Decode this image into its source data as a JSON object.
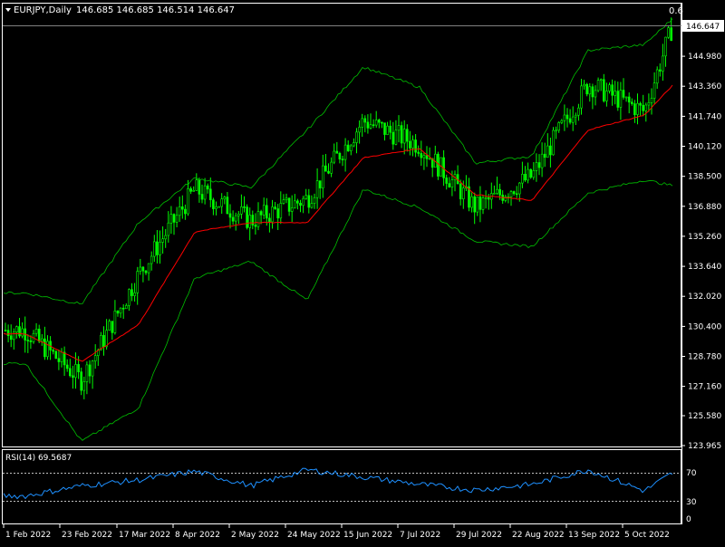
{
  "header": {
    "dropdown_icon": "triangle-down-icon",
    "symbol": "EURJPY,Daily",
    "ohlc": "146.685 146.685 146.514 146.647",
    "corner_value": "0.6"
  },
  "colors": {
    "background": "#000000",
    "candle": "#00ff00",
    "bands": "#00c000",
    "ma": "#ff0000",
    "rsi": "#1e90ff",
    "axis_text": "#ffffff",
    "current_price_bg": "#ffffff"
  },
  "price_axis": {
    "current_price": "146.647",
    "labels": [
      "144.980",
      "143.360",
      "141.740",
      "140.120",
      "138.500",
      "136.880",
      "135.260",
      "133.640",
      "132.020",
      "130.400",
      "128.780",
      "127.160",
      "125.580",
      "123.965"
    ]
  },
  "rsi_panel": {
    "label": "RSI(14) 69.5687",
    "levels": [
      "70",
      "30"
    ],
    "axis_labels": [
      "70",
      "30",
      "0"
    ]
  },
  "time_axis": {
    "labels": [
      "1 Feb 2022",
      "23 Feb 2022",
      "17 Mar 2022",
      "8 Apr 2022",
      "2 May 2022",
      "24 May 2022",
      "15 Jun 2022",
      "7 Jul 2022",
      "29 Jul 2022",
      "22 Aug 2022",
      "13 Sep 2022",
      "5 Oct 2022"
    ]
  },
  "chart_data": {
    "type": "line",
    "title": "EURJPY,Daily",
    "xlabel": "",
    "ylabel": "",
    "ylim": [
      123.965,
      147.4
    ],
    "x_ticks": [
      "1 Feb 2022",
      "23 Feb 2022",
      "17 Mar 2022",
      "8 Apr 2022",
      "2 May 2022",
      "24 May 2022",
      "15 Jun 2022",
      "7 Jul 2022",
      "29 Jul 2022",
      "22 Aug 2022",
      "13 Sep 2022",
      "5 Oct 2022"
    ],
    "x": [
      "1 Feb 2022",
      "23 Feb 2022",
      "17 Mar 2022",
      "8 Apr 2022",
      "2 May 2022",
      "24 May 2022",
      "15 Jun 2022",
      "7 Jul 2022",
      "29 Jul 2022",
      "22 Aug 2022",
      "13 Sep 2022",
      "5 Oct 2022",
      "13 Oct 2022"
    ],
    "series": [
      {
        "values": [
          130.2,
          127.5,
          133.2,
          137.8,
          136.1,
          137.3,
          141.5,
          140.2,
          136.8,
          138.5,
          143.5,
          142.0,
          146.6
        ]
      },
      {
        "values": [
          130.0,
          128.5,
          130.5,
          135.5,
          136.0,
          136.0,
          139.5,
          140.0,
          137.5,
          137.2,
          141.0,
          141.8,
          143.4
        ]
      },
      {
        "values": [
          132.2,
          131.6,
          136.0,
          138.4,
          137.9,
          141.0,
          144.4,
          143.3,
          139.2,
          139.6,
          145.3,
          145.6,
          147.0
        ]
      },
      {
        "values": [
          128.4,
          124.2,
          126.0,
          133.0,
          133.9,
          131.8,
          137.8,
          136.8,
          135.0,
          134.7,
          137.6,
          138.3,
          138.0
        ]
      }
    ],
    "rsi": {
      "ylim": [
        0,
        100
      ],
      "levels": [
        70,
        30
      ],
      "values": [
        38,
        52,
        60,
        72,
        52,
        74,
        64,
        54,
        46,
        54,
        74,
        45,
        69.5687
      ]
    },
    "grid": false,
    "legend": "none"
  }
}
